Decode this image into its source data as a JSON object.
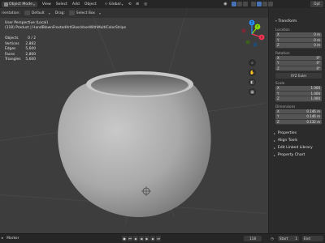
{
  "header": {
    "mode": "Object Mode",
    "menus": [
      "View",
      "Select",
      "Add",
      "Object"
    ],
    "orientation_label": "Global",
    "options_label": "Opt"
  },
  "tool_header": {
    "orientation_label": "rientation:",
    "orientation_value": "Default",
    "drag_label": "Drag:",
    "drag_value": "Select Box"
  },
  "axes": [
    "X",
    "Y",
    "Z"
  ],
  "viewport": {
    "view_name": "User Perspective (Local)",
    "object_info": "(118) Product | HandBlownFrostedArtGlassVaseWithMultiColorStripe",
    "stats": [
      {
        "label": "Objects",
        "value": "0 / 2"
      },
      {
        "label": "Vertices",
        "value": "2,882"
      },
      {
        "label": "Edges",
        "value": "5,600"
      },
      {
        "label": "Faces",
        "value": "2,800"
      },
      {
        "label": "Triangles",
        "value": "5,600"
      }
    ]
  },
  "sidebar": {
    "title": "Transform",
    "location_label": "Location",
    "location": [
      {
        "axis": "X",
        "value": "0 m"
      },
      {
        "axis": "Y",
        "value": "0 m"
      },
      {
        "axis": "Z",
        "value": "0 m"
      }
    ],
    "rotation_label": "Rotation",
    "rotation": [
      {
        "axis": "X",
        "value": "0°"
      },
      {
        "axis": "Y",
        "value": "0°"
      },
      {
        "axis": "Z",
        "value": "0°"
      }
    ],
    "rotation_mode": "XYZ Euler",
    "scale_label": "Scale",
    "scale": [
      {
        "axis": "X",
        "value": "1.000"
      },
      {
        "axis": "Y",
        "value": "1.000"
      },
      {
        "axis": "Z",
        "value": "1.000"
      }
    ],
    "dimensions_label": "Dimensions",
    "dimensions": [
      {
        "axis": "X",
        "value": "0.146 m"
      },
      {
        "axis": "Y",
        "value": "0.146 m"
      },
      {
        "axis": "Z",
        "value": "0.132 m"
      }
    ],
    "collapsed": [
      "Properties",
      "Align Tools",
      "Edit Linked Library",
      "Property Chart"
    ]
  },
  "timeline": {
    "left_label": "Marker",
    "current_frame": "118",
    "start_label": "Start",
    "start_value": "1",
    "end_label": "End"
  },
  "colors": {
    "accent": "#4772b3",
    "axis_x": "#ff3352",
    "axis_y": "#8bdc00",
    "axis_z": "#2890ff"
  }
}
